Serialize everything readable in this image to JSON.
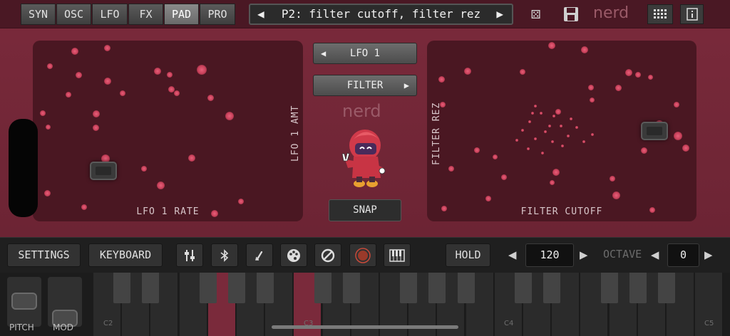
{
  "tabs": [
    {
      "label": "SYN",
      "active": false
    },
    {
      "label": "OSC",
      "active": false
    },
    {
      "label": "LFO",
      "active": false
    },
    {
      "label": "FX",
      "active": false
    },
    {
      "label": "PAD",
      "active": true
    },
    {
      "label": "PRO",
      "active": false
    }
  ],
  "preset": {
    "label": "P2: filter cutoff, filter rez"
  },
  "header_icons": {
    "dice": "dice-icon",
    "save": "save-icon",
    "logo": "nerd",
    "grid": "grid-icon",
    "info": "info-icon"
  },
  "left_pad": {
    "x_label": "LFO 1 RATE",
    "y_label": "LFO 1 AMT"
  },
  "right_pad": {
    "x_label": "FILTER CUTOFF",
    "y_label": "FILTER REZ"
  },
  "center": {
    "source_label": "LFO 1",
    "target_label": "FILTER",
    "logo": "nerd",
    "snap_label": "SNAP"
  },
  "toolbar": {
    "settings_label": "SETTINGS",
    "keyboard_label": "KEYBOARD",
    "hold_label": "HOLD",
    "tempo_value": "120",
    "octave_label": "OCTAVE",
    "octave_value": "0",
    "icons": [
      "mixer-sliders-icon",
      "bluetooth-icon",
      "link-icon",
      "palette-icon",
      "no-entry-icon",
      "record-icon",
      "piano-icon"
    ]
  },
  "keyboard": {
    "pitch_label": "PITCH",
    "mod_label": "MOD",
    "octave_labels": [
      "C2",
      "C3",
      "C4",
      "C5"
    ]
  },
  "colors": {
    "accent": "#7a2a3b",
    "pad_bg": "#4a1722",
    "dot": "#d8506a"
  }
}
